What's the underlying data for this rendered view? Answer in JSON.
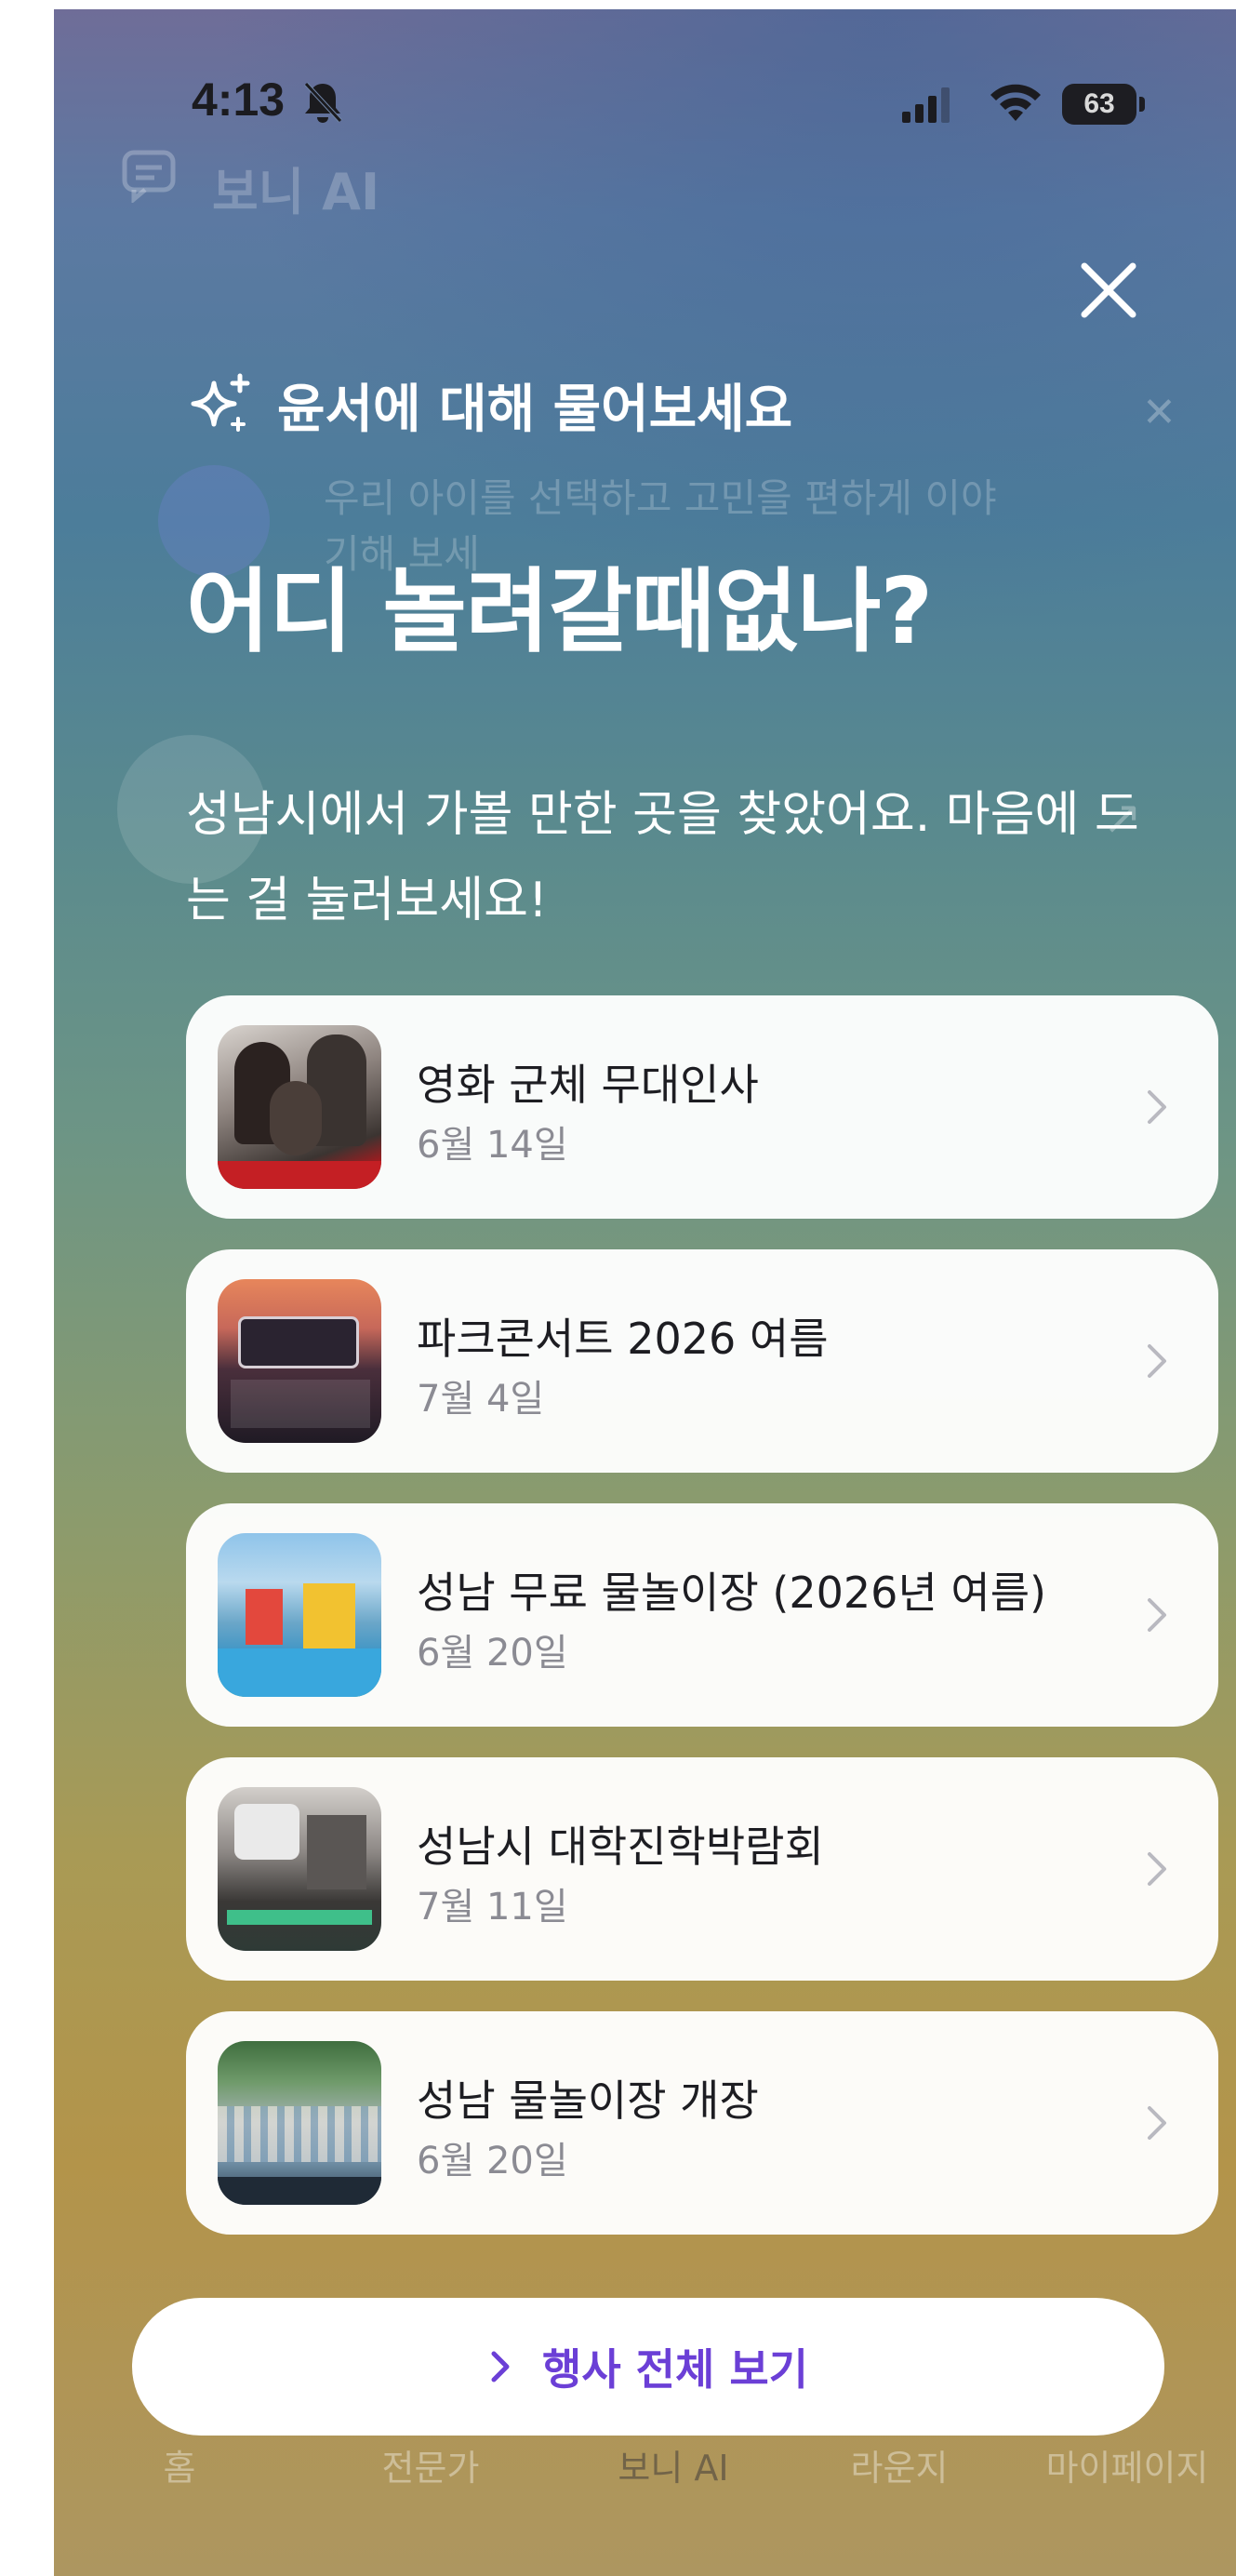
{
  "status_bar": {
    "time": "4:13",
    "battery": "63"
  },
  "background_app": {
    "header_title": "보니 AI",
    "banner_text_line1": "우리 아이를 선택하고 고민을 편하게 이야",
    "banner_text_line2": "기해 보세",
    "tabs": [
      "홈",
      "전문가",
      "보니 AI",
      "라운지",
      "마이페이지"
    ]
  },
  "overlay": {
    "subtitle": "윤서에 대해 물어보세요",
    "headline": "어디 놀려갈때없나?",
    "description": "성남시에서 가볼 만한 곳을 찾았어요. 마음에 드는 걸 눌러보세요!",
    "events": [
      {
        "title": "영화 군체 무대인사",
        "date": "6월 14일"
      },
      {
        "title": "파크콘서트 2026 여름",
        "date": "7월 4일"
      },
      {
        "title": "성남 무료 물놀이장 (2026년 여름)",
        "date": "6월 20일"
      },
      {
        "title": "성남시 대학진학박람회",
        "date": "7월 11일"
      },
      {
        "title": "성남 물놀이장 개장",
        "date": "6월 20일"
      }
    ],
    "view_all_label": "행사 전체 보기"
  },
  "colors": {
    "accent": "#6b3fd6",
    "card_bg": "#ffffff",
    "date_text": "#8b8b93"
  }
}
